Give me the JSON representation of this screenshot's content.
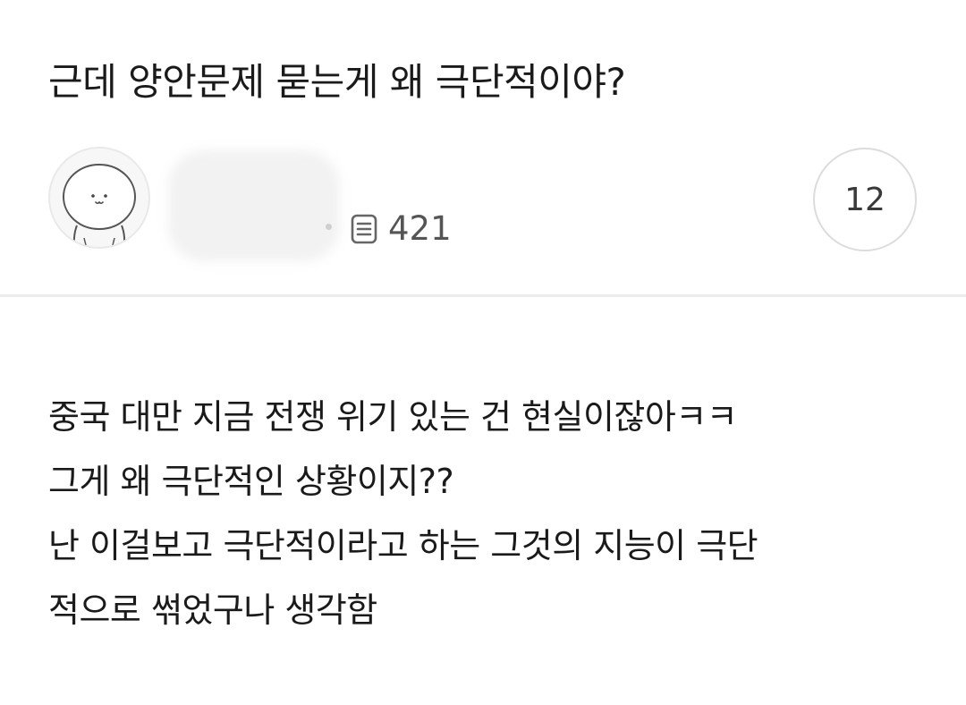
{
  "post": {
    "title": "근데 양안문제 묻는게 왜 극단적이야?",
    "author": {
      "name": "익명",
      "avatar_icon": "smiling-seal-avatar",
      "post_count": "421",
      "post_count_icon": "document-icon"
    },
    "comment_count": "12",
    "body_lines": [
      "중국 대만 지금 전쟁 위기 있는 건 현실이잖아ㅋㅋ",
      "그게 왜 극단적인 상황이지??",
      "난 이걸보고 극단적이라고 하는 그것의 지능이 극단",
      "적으로 썪었구나 생각함"
    ]
  },
  "colors": {
    "text_primary": "#1a1a1a",
    "text_secondary": "#555555",
    "divider": "#ececec",
    "badge_border": "#dcdcdc"
  }
}
